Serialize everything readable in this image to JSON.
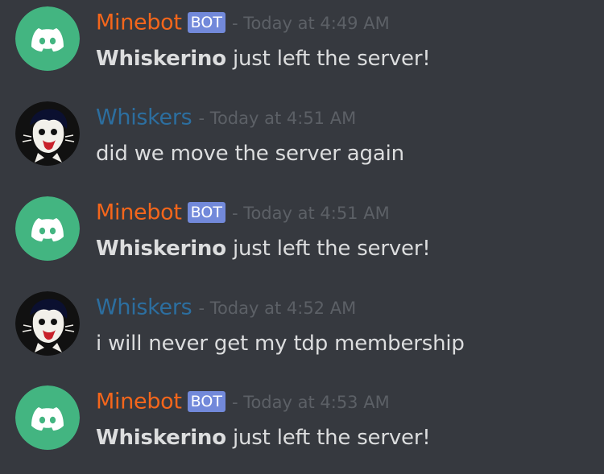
{
  "colors": {
    "background": "#36393f",
    "bot_name": "#f4661b",
    "user_name": "#2c6e9f",
    "bot_tag": "#7289da",
    "discord_green": "#43b581",
    "timestamp": "#5c6066",
    "text": "#dcddde"
  },
  "messages": [
    {
      "author": "Minebot",
      "is_bot": true,
      "bot_tag": "BOT",
      "avatar_icon": "discord-logo-icon",
      "timestamp": "- Today at 4:49 AM",
      "bold": "Whiskerino",
      "text": " just left the server!"
    },
    {
      "author": "Whiskers",
      "is_bot": false,
      "avatar_icon": "cartoon-cat-avatar",
      "timestamp": "- Today at 4:51 AM",
      "bold": "",
      "text": "did we move the server again"
    },
    {
      "author": "Minebot",
      "is_bot": true,
      "bot_tag": "BOT",
      "avatar_icon": "discord-logo-icon",
      "timestamp": "- Today at 4:51 AM",
      "bold": "Whiskerino",
      "text": " just left the server!"
    },
    {
      "author": "Whiskers",
      "is_bot": false,
      "avatar_icon": "cartoon-cat-avatar",
      "timestamp": "- Today at 4:52 AM",
      "bold": "",
      "text": "i will never get my tdp membership"
    },
    {
      "author": "Minebot",
      "is_bot": true,
      "bot_tag": "BOT",
      "avatar_icon": "discord-logo-icon",
      "timestamp": "- Today at 4:53 AM",
      "bold": "Whiskerino",
      "text": " just left the server!"
    }
  ]
}
